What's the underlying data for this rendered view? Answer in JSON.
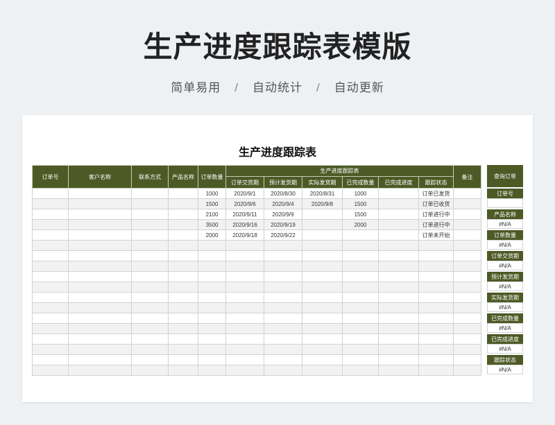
{
  "header": {
    "title": "生产进度跟踪表模版",
    "features": [
      "简单易用",
      "自动统计",
      "自动更新"
    ],
    "separator": "/"
  },
  "sheet": {
    "title": "生产进度跟踪表",
    "columns": {
      "order_no": "订单号",
      "customer": "客户名称",
      "contact": "联系方式",
      "product": "产品名称",
      "qty": "订单数量",
      "group": "生产进度跟踪表",
      "delivery_due": "订单交货期",
      "planned_ship": "预计发货期",
      "actual_ship": "实际发货期",
      "done_qty": "已完成数量",
      "done_pct": "已完成进度",
      "status": "跟踪状态",
      "remark": "备注"
    },
    "rows": [
      {
        "qty": "1000",
        "delivery_due": "2020/9/1",
        "planned_ship": "2020/8/30",
        "actual_ship": "2020/8/31",
        "done_qty": "1000",
        "status": "订单已发货"
      },
      {
        "qty": "1500",
        "delivery_due": "2020/9/6",
        "planned_ship": "2020/9/4",
        "actual_ship": "2020/9/8",
        "done_qty": "1500",
        "status": "订单已收货"
      },
      {
        "qty": "2100",
        "delivery_due": "2020/9/11",
        "planned_ship": "2020/9/9",
        "actual_ship": "",
        "done_qty": "1500",
        "status": "订单进行中"
      },
      {
        "qty": "3500",
        "delivery_due": "2020/9/16",
        "planned_ship": "2020/9/19",
        "actual_ship": "",
        "done_qty": "2000",
        "status": "订单进行中"
      },
      {
        "qty": "2000",
        "delivery_due": "2020/9/18",
        "planned_ship": "2020/9/22",
        "actual_ship": "",
        "done_qty": "",
        "status": "订单未开始"
      }
    ],
    "empty_rows": 13
  },
  "lookup": {
    "title": "查询订单",
    "fields": [
      {
        "label": "订单号",
        "value": ""
      },
      {
        "label": "产品名称",
        "value": "#N/A"
      },
      {
        "label": "订单数量",
        "value": "#N/A"
      },
      {
        "label": "订单交货期",
        "value": "#N/A"
      },
      {
        "label": "预计发货期",
        "value": "#N/A"
      },
      {
        "label": "实际发货期",
        "value": "#N/A"
      },
      {
        "label": "已完成数量",
        "value": "#N/A"
      },
      {
        "label": "已完成进度",
        "value": "#N/A"
      },
      {
        "label": "跟踪状态",
        "value": "#N/A"
      }
    ]
  }
}
